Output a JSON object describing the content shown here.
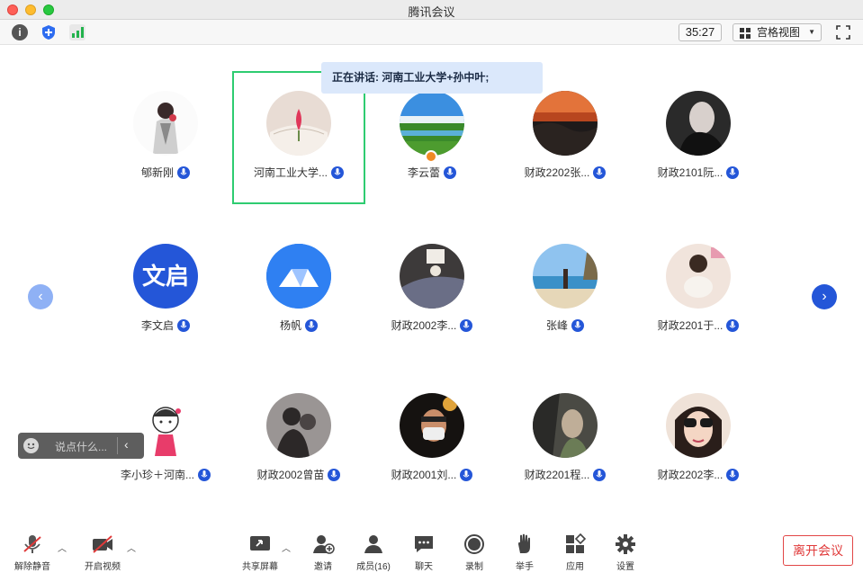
{
  "window": {
    "title": "腾讯会议"
  },
  "topbar": {
    "timer": "35:27",
    "view_label": "宫格视图"
  },
  "speaking": "正在讲话: 河南工业大学+孙中叶;",
  "participants": [
    {
      "name": "郇新刚",
      "avatar": "photo-person"
    },
    {
      "name": "河南工业大学...",
      "avatar": "photo-book"
    },
    {
      "name": "李云蕾",
      "avatar": "photo-landscape"
    },
    {
      "name": "财政2202张...",
      "avatar": "photo-sunset"
    },
    {
      "name": "财政2101阮...",
      "avatar": "photo-dark"
    },
    {
      "name": "李文启",
      "avatar": "text",
      "avatar_text": "文启"
    },
    {
      "name": "杨帆",
      "avatar": "logo"
    },
    {
      "name": "财政2002李...",
      "avatar": "photo-cat"
    },
    {
      "name": "张峰",
      "avatar": "photo-beach"
    },
    {
      "name": "财政2201于...",
      "avatar": "photo-pet"
    },
    {
      "name": "李小珍＋河南...",
      "avatar": "cartoon"
    },
    {
      "name": "财政2002曾苗",
      "avatar": "photo-silhouette"
    },
    {
      "name": "财政2001刘...",
      "avatar": "photo-mask"
    },
    {
      "name": "财政2201程...",
      "avatar": "photo-girl"
    },
    {
      "name": "财政2202李...",
      "avatar": "photo-sunglasses"
    }
  ],
  "chat": {
    "placeholder": "说点什么..."
  },
  "controls": {
    "unmute": "解除静音",
    "start_video": "开启视频",
    "share": "共享屏幕",
    "invite": "邀请",
    "members": "成员(16)",
    "chat": "聊天",
    "record": "录制",
    "raise_hand": "举手",
    "apps": "应用",
    "settings": "设置",
    "leave": "离开会议"
  },
  "colors": {
    "accent": "#2456d8",
    "active_border": "#2ecc71",
    "leave": "#e03a3a"
  }
}
